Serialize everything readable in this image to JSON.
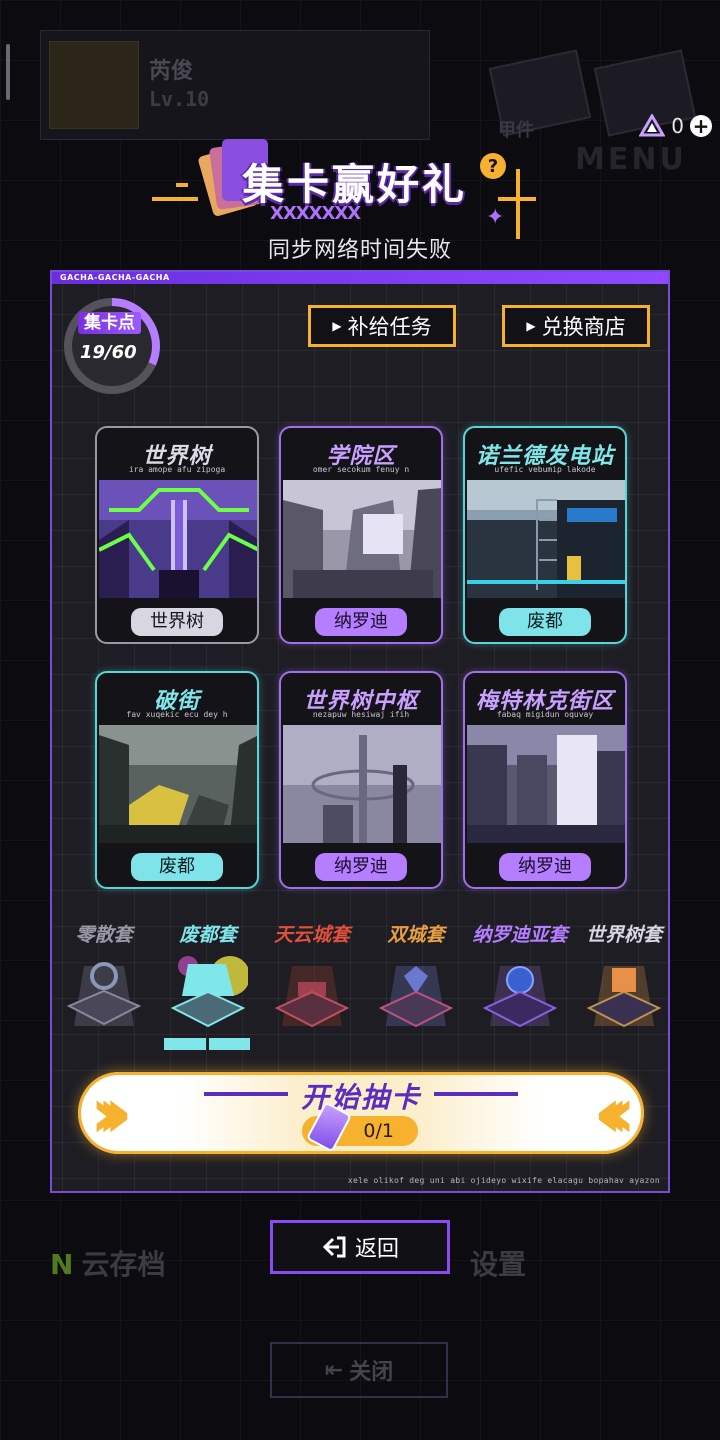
{
  "background": {
    "profile_name": "芮俊",
    "profile_level": "Lv.10",
    "tile_label": "甲件",
    "menu_word": "MENU",
    "cloud_save": "云存档",
    "setting_fragment": "设置",
    "close_button": "关闭"
  },
  "currency": {
    "value": "0",
    "icon": "gem-icon"
  },
  "event": {
    "title": "集卡赢好礼",
    "status": "同步网络时间失败"
  },
  "panel": {
    "header": "GACHA-GACHA-GACHA",
    "footer": "xele olikof deg uni abi ojideyo wixife elacagu bopahav ayazon",
    "points": {
      "label": "集卡点",
      "value": "19/60",
      "progress": 0.3167
    },
    "buttons": {
      "mission": "补给任务",
      "shop": "兑换商店"
    },
    "cards": [
      {
        "title": "世界树",
        "subtitle": "ira amope afu zipoga",
        "badge": "世界树",
        "theme": "gray"
      },
      {
        "title": "学院区",
        "subtitle": "omer secokum fenuy n",
        "badge": "纳罗迪亚",
        "theme": "purple"
      },
      {
        "title": "诺兰德发电站",
        "subtitle": "ufefic vebumip lakode",
        "badge": "废都",
        "theme": "cyan"
      },
      {
        "title": "破街",
        "subtitle": "fav xuqekic ecu dey h",
        "badge": "废都",
        "theme": "cyan"
      },
      {
        "title": "世界树中枢",
        "subtitle": "nezapuw hesiwaj ifih",
        "badge": "纳罗迪亚",
        "theme": "purple"
      },
      {
        "title": "梅特林克街区",
        "subtitle": "fabaq migidun oquvay",
        "badge": "纳罗迪亚",
        "theme": "purple"
      }
    ],
    "packs": [
      {
        "name": "零散套",
        "color": "#9a98a6"
      },
      {
        "name": "废都套",
        "color": "#7fe6ea",
        "selected": true
      },
      {
        "name": "天云城套",
        "color": "#e0503a"
      },
      {
        "name": "双城套",
        "color": "#e8a040"
      },
      {
        "name": "纳罗迪亚套",
        "color": "#b57dff"
      },
      {
        "name": "世界树套",
        "color": "#d8d6e0"
      }
    ],
    "draw": {
      "label": "开始抽卡",
      "count": "0/1"
    }
  },
  "back_button": "返回",
  "colors": {
    "accent": "#8a4cf0",
    "gold": "#f6b12e",
    "cyan": "#7fe6ea",
    "purple": "#b57dff"
  }
}
